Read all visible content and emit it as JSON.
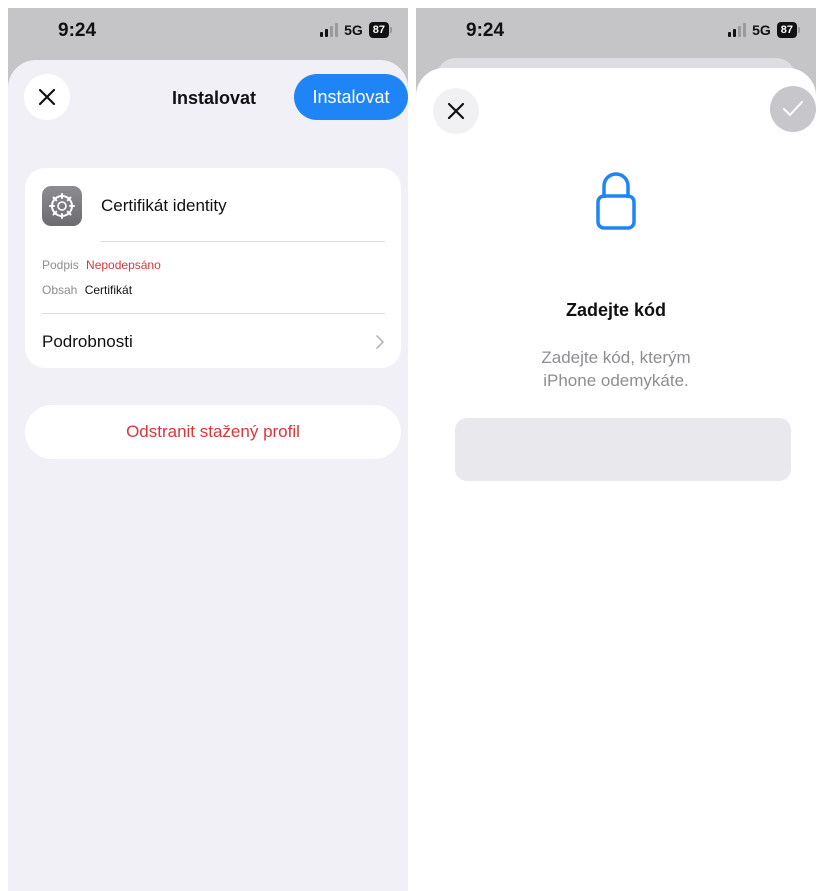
{
  "left_screen": {
    "status": {
      "time": "9:24",
      "network": "5G",
      "battery": "87"
    },
    "header": {
      "title": "Instalovat",
      "install_label": "Instalovat"
    },
    "profile": {
      "name": "Certifikát identity",
      "signature_label": "Podpis",
      "signature_value": "Nepodepsáno",
      "content_label": "Obsah",
      "content_value": "Certifikát",
      "details_label": "Podrobnosti"
    },
    "remove_label": "Odstranit stažený profil"
  },
  "right_screen": {
    "status": {
      "time": "9:24",
      "network": "5G",
      "battery": "87"
    },
    "passcode": {
      "title": "Zadejte kód",
      "subtitle_line1": "Zadejte kód, kterým",
      "subtitle_line2": "iPhone odemykáte.",
      "value": ""
    }
  },
  "colors": {
    "accent": "#1f85f7",
    "destructive": "#d9363a",
    "sheet_background": "#f1f0f6",
    "disabled": "#c7c7cb"
  },
  "icons": [
    "close-icon",
    "settings-gear-icon",
    "chevron-right-icon",
    "lock-icon",
    "checkmark-icon",
    "signal-icon",
    "battery-icon"
  ]
}
